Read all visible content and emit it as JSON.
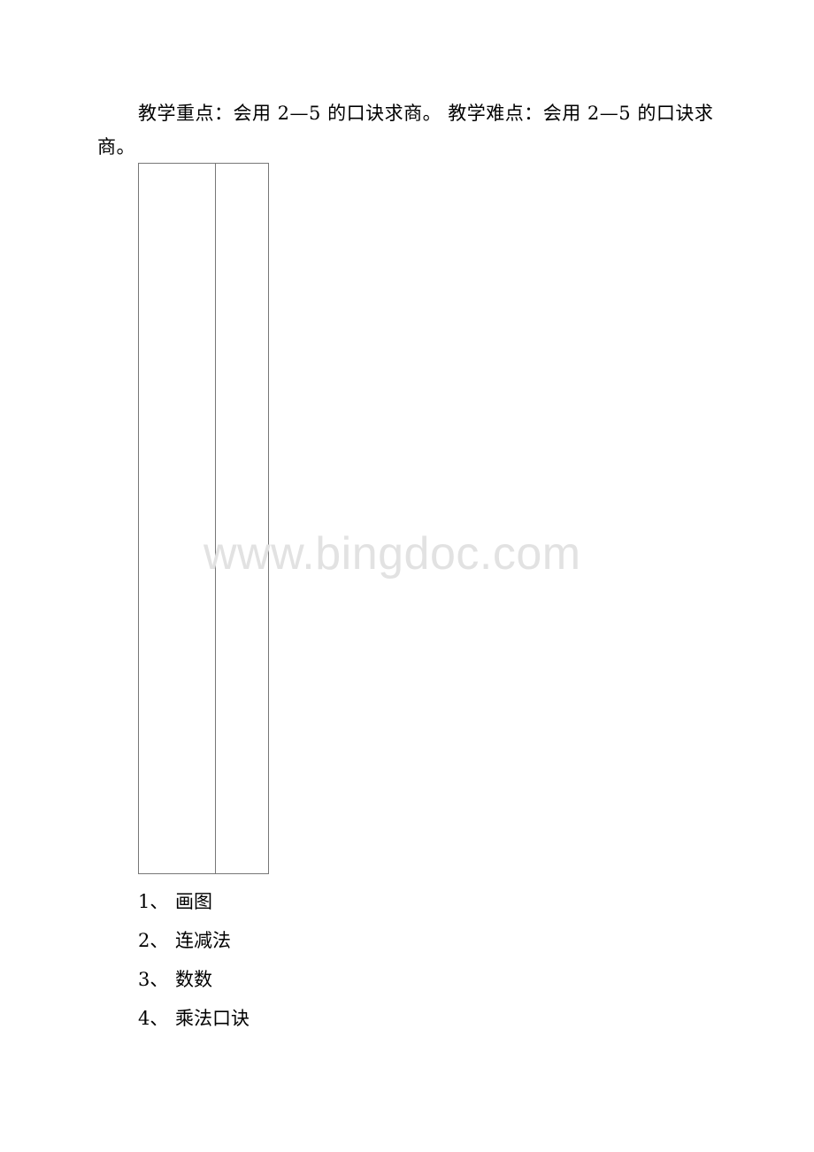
{
  "document": {
    "paragraph": "教学重点：会用 2—5 的口诀求商。 教学难点：会用 2—5 的口诀求商。",
    "list": [
      {
        "number": "1、",
        "text": "画图"
      },
      {
        "number": "2、",
        "text": "连减法"
      },
      {
        "number": "3、",
        "text": "数数"
      },
      {
        "number": "4、",
        "text": "乘法口诀"
      }
    ],
    "watermark": "www.bingdoc.com"
  }
}
